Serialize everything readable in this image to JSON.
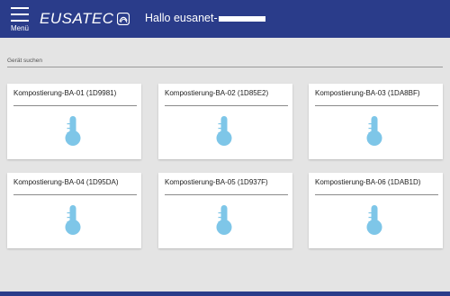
{
  "header": {
    "menu_label": "Menü",
    "logo_text": "EUSATEC",
    "greeting": "Hallo eusanet-",
    "colors": {
      "bar": "#2a3c8a",
      "text": "#ffffff"
    }
  },
  "search": {
    "placeholder": "Gerät suchen",
    "value": ""
  },
  "devices": [
    {
      "name": "Kompostierung-BA-01 (1D9981)",
      "icon": "thermometer-icon"
    },
    {
      "name": "Kompostierung-BA-02 (1D85E2)",
      "icon": "thermometer-icon"
    },
    {
      "name": "Kompostierung-BA-03 (1DA8BF)",
      "icon": "thermometer-icon"
    },
    {
      "name": "Kompostierung-BA-04 (1D95DA)",
      "icon": "thermometer-icon"
    },
    {
      "name": "Kompostierung-BA-05 (1D937F)",
      "icon": "thermometer-icon"
    },
    {
      "name": "Kompostierung-BA-06 (1DAB1D)",
      "icon": "thermometer-icon"
    }
  ],
  "colors": {
    "thermometer": "#7ec6e8",
    "background": "#e4e4e4"
  }
}
